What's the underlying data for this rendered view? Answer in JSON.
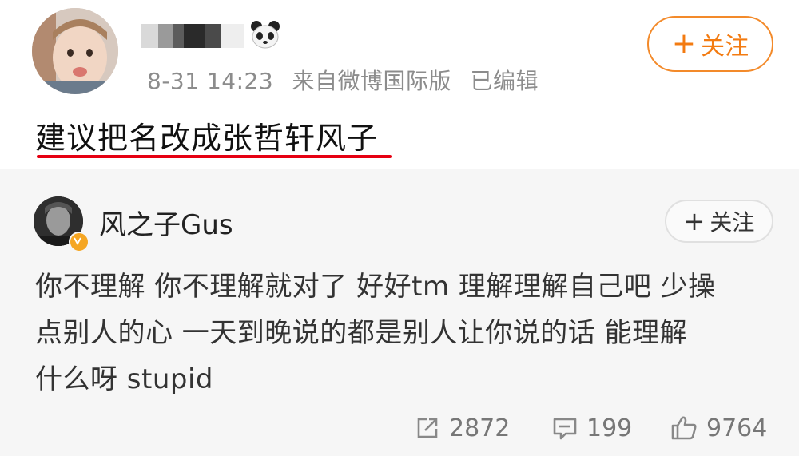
{
  "post": {
    "timestamp": "8-31 14:23",
    "source": "来自微博国际版",
    "edited": "已编辑",
    "follow_label": "关注",
    "text": "建议把名改成张哲轩风子"
  },
  "quoted": {
    "username": "风之子Gus",
    "follow_label": "关注",
    "text_lines": [
      "你不理解 你不理解就对了 好好tm 理解理解自己吧 少操",
      "点别人的心 一天到晚说的都是别人让你说的话 能理解",
      "什么呀 stupid"
    ],
    "reposts": "2872",
    "comments": "199",
    "likes": "9764"
  },
  "colors": {
    "accent_orange": "#f37b11",
    "underline_red": "#e60012",
    "quote_bg": "#f6f6f6",
    "meta_gray": "#8c8c8c"
  },
  "icons": [
    "panda-icon",
    "verified-badge-icon",
    "repost-icon",
    "comment-icon",
    "like-icon"
  ]
}
